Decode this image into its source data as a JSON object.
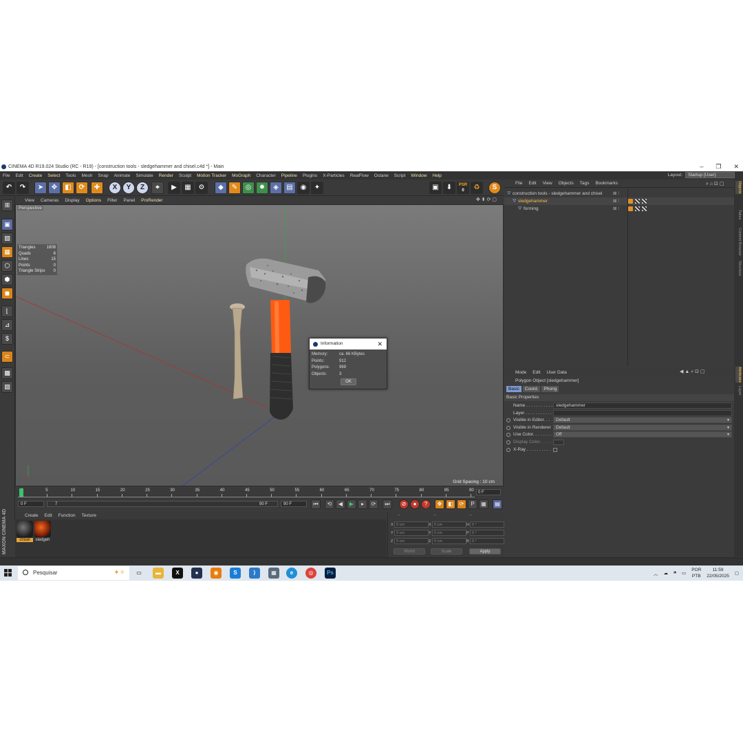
{
  "window": {
    "title": "CINEMA 4D R19.024 Studio (RC - R19) - [construction tools - sledgehammer and chisel.c4d *] - Main",
    "controls": [
      "–",
      "❐",
      "✕"
    ]
  },
  "menu": {
    "items": [
      "File",
      "Edit",
      "Create",
      "Select",
      "Tools",
      "Mesh",
      "Snap",
      "Animate",
      "Simulate",
      "Render",
      "Sculpt",
      "Motion Tracker",
      "MoGraph",
      "Character",
      "Pipeline",
      "Plugins",
      "X-Particles",
      "RealFlow",
      "Octane",
      "Script",
      "Window",
      "Help"
    ],
    "highlighted": [
      "Create",
      "Select",
      "Render",
      "Motion Tracker",
      "MoGraph",
      "Pipeline",
      "Window",
      "Help"
    ],
    "layout_label": "Layout:",
    "layout_value": "Startup (User)"
  },
  "toolbar": {
    "axis_x": "X",
    "axis_y": "Y",
    "axis_z": "Z",
    "psr_label": "PSR",
    "psr_value": "0",
    "s_button": "S"
  },
  "viewport": {
    "menu": [
      "View",
      "Cameras",
      "Display",
      "Options",
      "Filter",
      "Panel",
      "ProRender"
    ],
    "highlighted": [
      "Options",
      "ProRender"
    ],
    "camera_label": "Perspective",
    "grid_spacing": "Grid Spacing : 10 cm",
    "stats": [
      {
        "k": "Triangles",
        "v": "1808"
      },
      {
        "k": "Quads",
        "v": "6"
      },
      {
        "k": "Lines",
        "v": "15"
      },
      {
        "k": "Points",
        "v": "0"
      },
      {
        "k": "Triangle Strips",
        "v": "0"
      }
    ]
  },
  "dialog": {
    "title": "Information",
    "rows": [
      {
        "k": "Memory:",
        "v": "ca. 66 KBytes"
      },
      {
        "k": "Points:",
        "v": "912"
      },
      {
        "k": "Polygons:",
        "v": "969"
      },
      {
        "k": "Objects:",
        "v": "3"
      }
    ],
    "ok": "OK"
  },
  "timeline": {
    "ticks": [
      "0",
      "5",
      "10",
      "15",
      "20",
      "25",
      "30",
      "35",
      "40",
      "45",
      "50",
      "55",
      "60",
      "65",
      "70",
      "75",
      "80",
      "85",
      "90"
    ],
    "current_frame": "0 F",
    "start_field": "0 F",
    "end_field": "90 F",
    "range_start": "0 F",
    "range_end": "90 F",
    "slider_value": "7"
  },
  "materials": {
    "menu": [
      "Create",
      "Edit",
      "Function",
      "Texture"
    ],
    "items": [
      {
        "name": "chisel",
        "selected": true
      },
      {
        "name": "sledgeh",
        "selected": false
      }
    ]
  },
  "coords": {
    "header": [
      "--",
      "--",
      "--"
    ],
    "rows": [
      [
        {
          "a": "X",
          "v": "0 cm"
        },
        {
          "a": "X",
          "v": "0 cm"
        },
        {
          "a": "H",
          "v": "0 °"
        }
      ],
      [
        {
          "a": "Y",
          "v": "0 cm"
        },
        {
          "a": "Y",
          "v": "0 cm"
        },
        {
          "a": "P",
          "v": "0 °"
        }
      ],
      [
        {
          "a": "Z",
          "v": "0 cm"
        },
        {
          "a": "Z",
          "v": "0 cm"
        },
        {
          "a": "B",
          "v": "0 °"
        }
      ]
    ],
    "mode1": "World",
    "mode2": "Scale",
    "apply": "Apply"
  },
  "objects": {
    "menu": [
      "File",
      "Edit",
      "View",
      "Objects",
      "Tags",
      "Bookmarks"
    ],
    "items": [
      {
        "name": "construction tools - sledgehammer and chisel",
        "indent": 12,
        "selected": false
      },
      {
        "name": "sledgehammer",
        "indent": 20,
        "selected": true
      },
      {
        "name": "forming",
        "indent": 28,
        "selected": false
      }
    ]
  },
  "attributes": {
    "menu": [
      "Mode",
      "Edit",
      "User Data"
    ],
    "object": "Polygon Object [sledgehammer]",
    "tabs": [
      "Basic",
      "Coord.",
      "Phong"
    ],
    "active_tab": "Basic",
    "section": "Basic Properties",
    "rows": [
      {
        "label": "Name . . . . . . . . . . .",
        "value": "sledgehammer",
        "type": "text"
      },
      {
        "label": "Layer . . . . . . . . . . .",
        "value": "",
        "type": "text"
      },
      {
        "label": "Visible in Editor. . .",
        "value": "Default",
        "type": "dd"
      },
      {
        "label": "Visible in Renderer",
        "value": "Default",
        "type": "dd"
      },
      {
        "label": "Use Color. . . . . . . .",
        "value": "Off",
        "type": "dd"
      },
      {
        "label": "Display Color. . . . .",
        "value": "",
        "type": "none"
      },
      {
        "label": "X-Ray . . . . . . . . . .",
        "value": "",
        "type": "check"
      }
    ]
  },
  "right_tabs": [
    "Objects",
    "Takes",
    "Content Browser",
    "Structure",
    "Attributes",
    "Layer"
  ],
  "brand": "MAXON CINEMA 4D",
  "taskbar": {
    "search_placeholder": "Pesquisar",
    "lang_top": "POR",
    "lang_bottom": "PTB",
    "time": "11:59",
    "date": "22/05/2025"
  }
}
